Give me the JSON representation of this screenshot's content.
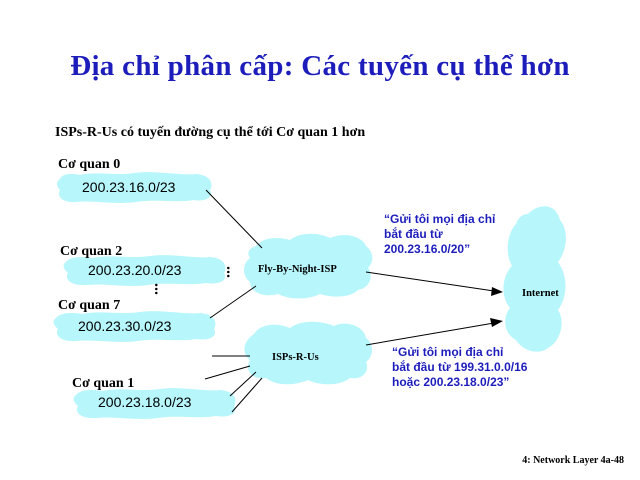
{
  "slide": {
    "title": "Địa chỉ phân cấp: Các tuyến cụ thể hơn",
    "subtitle": "ISPs-R-Us có tuyến đường cụ thể tới Cơ quan 1 hơn",
    "footer": "4: Network Layer    4a-48"
  },
  "organizations": [
    {
      "name": "Cơ quan 0",
      "prefix": "200.23.16.0/23"
    },
    {
      "name": "Cơ quan 2",
      "prefix": "200.23.20.0/23"
    },
    {
      "name": "Cơ quan 7",
      "prefix": "200.23.30.0/23"
    },
    {
      "name": "Cơ quan 1",
      "prefix": "200.23.18.0/23"
    }
  ],
  "isps": {
    "fly": "Fly-By-Night-ISP",
    "rus": "ISPs-R-Us",
    "internet": "Internet"
  },
  "ellipsis_dots": ". . .",
  "advertisements": {
    "fly": [
      "“Gửi tôi mọi địa chỉ",
      "bắt đầu từ",
      "200.23.16.0/20”"
    ],
    "rus": [
      "“Gửi tôi mọi địa chỉ",
      "bắt đầu từ 199.31.0.0/16",
      "hoặc 200.23.18.0/23”"
    ]
  },
  "colors": {
    "cloud": "#b7f6fb",
    "title_blue": "#1d1dbb"
  }
}
